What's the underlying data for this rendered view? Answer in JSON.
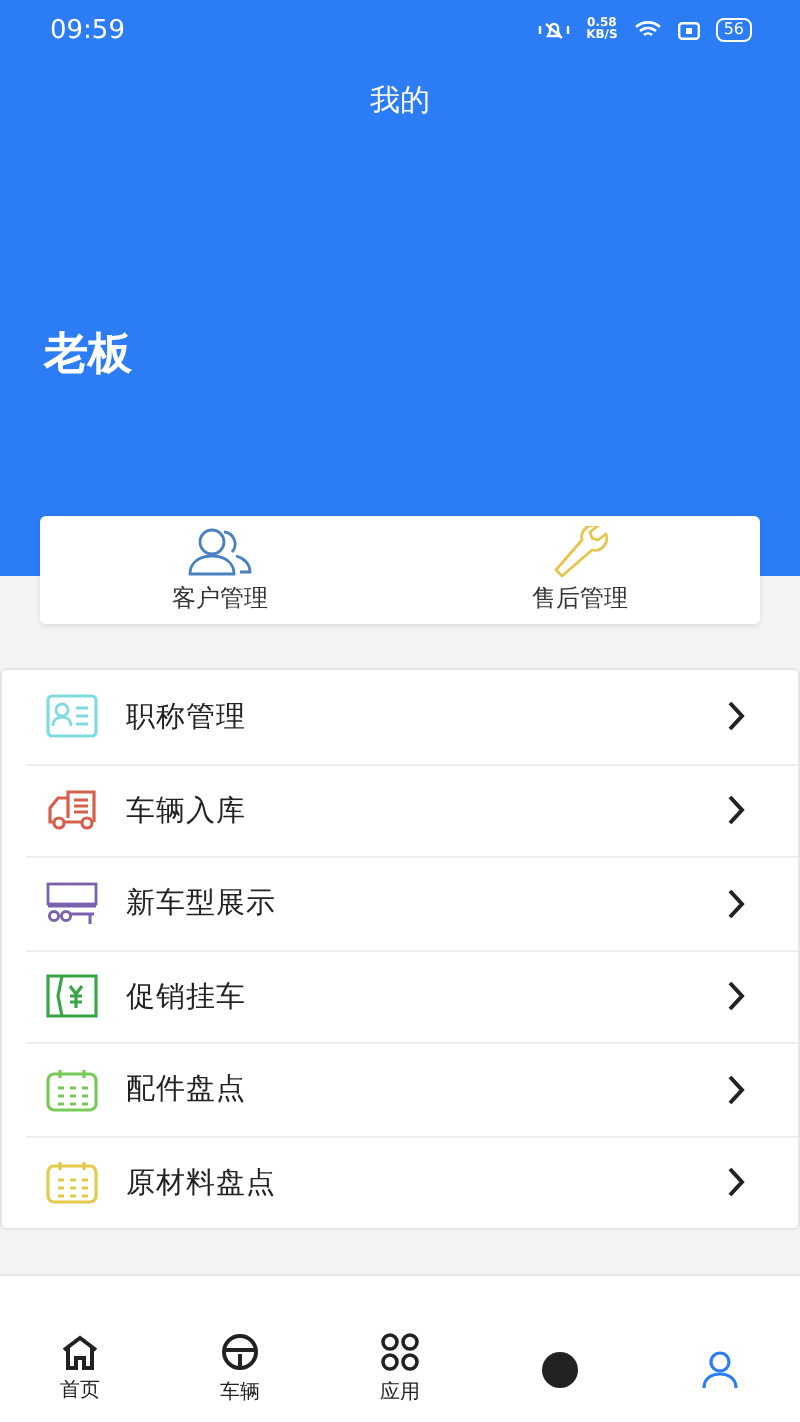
{
  "status_bar": {
    "time": "09:59",
    "speed": "0.58",
    "speed_unit": "KB/S",
    "battery": "56"
  },
  "title": "我的",
  "profile": {
    "name": "老板"
  },
  "quick_actions": [
    {
      "kind": "customers",
      "label": "客户管理"
    },
    {
      "kind": "service",
      "label": "售后管理"
    }
  ],
  "menu": [
    {
      "kind": "idcard",
      "label": "职称管理"
    },
    {
      "kind": "truck",
      "label": "车辆入库"
    },
    {
      "kind": "new",
      "label": "新车型展示"
    },
    {
      "kind": "coupon",
      "label": "促销挂车"
    },
    {
      "kind": "calendar_green",
      "label": "配件盘点"
    },
    {
      "kind": "calendar_yellow",
      "label": "原材料盘点"
    }
  ],
  "tabs": [
    {
      "kind": "home",
      "label": "首页",
      "selected": false
    },
    {
      "kind": "wheel",
      "label": "车辆",
      "selected": false
    },
    {
      "kind": "apps",
      "label": "应用",
      "selected": false
    },
    {
      "kind": "dot",
      "selected": false
    },
    {
      "kind": "person",
      "selected": true
    }
  ]
}
